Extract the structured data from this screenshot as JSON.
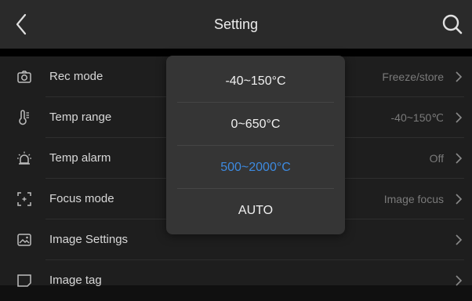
{
  "header": {
    "title": "Setting",
    "back_icon": "chevron-left-icon",
    "search_icon": "search-icon"
  },
  "settings": {
    "items": [
      {
        "label": "Rec mode",
        "value": "Freeze/store",
        "icon": "camera-icon"
      },
      {
        "label": "Temp range",
        "value": "-40~150℃",
        "icon": "thermometer-icon"
      },
      {
        "label": "Temp alarm",
        "value": "Off",
        "icon": "alarm-icon"
      },
      {
        "label": "Focus mode",
        "value": "Image focus",
        "icon": "focus-icon"
      },
      {
        "label": "Image Settings",
        "value": "",
        "icon": "image-icon"
      },
      {
        "label": "Image tag",
        "value": "",
        "icon": "tag-icon"
      }
    ]
  },
  "popup": {
    "options": [
      "-40~150°C",
      "0~650°C",
      "500~2000°C",
      "AUTO"
    ],
    "selected": "500~2000°C",
    "accent_color": "#3d8ae0"
  }
}
